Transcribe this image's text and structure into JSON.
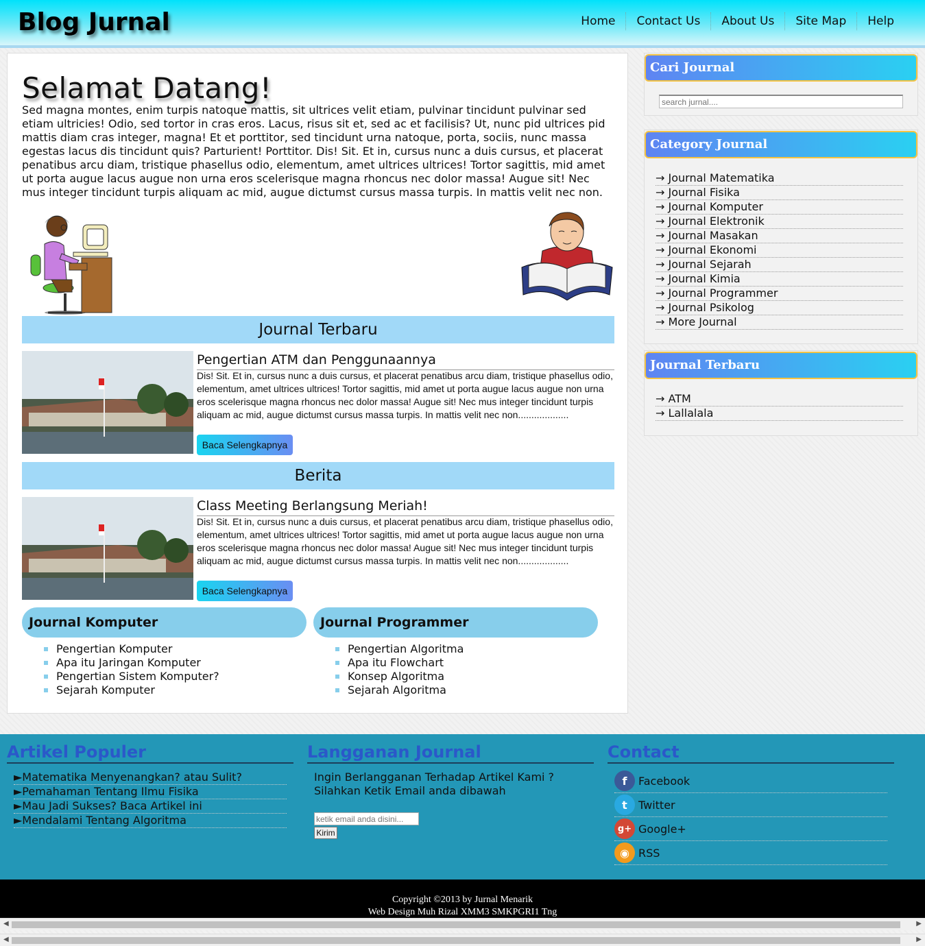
{
  "header": {
    "logo": "Blog Jurnal",
    "nav": [
      "Home",
      "Contact Us",
      "About Us",
      "Site Map",
      "Help"
    ]
  },
  "main": {
    "welcome_title": "Selamat Datang!",
    "intro": "Sed magna montes, enim turpis natoque mattis, sit ultrices velit etiam, pulvinar tincidunt pulvinar sed etiam ultricies! Odio, sed tortor in cras eros. Lacus, risus sit et, sed ac et facilisis? Ut, nunc pid ultrices pid mattis diam cras integer, magna! Et et porttitor, sed tincidunt urna natoque, porta, sociis, nunc massa egestas lacus dis tincidunt quis? Parturient! Porttitor. Dis! Sit. Et in, cursus nunc a duis cursus, et placerat penatibus arcu diam, tristique phasellus odio, elementum, amet ultrices ultrices! Tortor sagittis, mid amet ut porta augue lacus augue non urna eros scelerisque magna rhoncus nec dolor massa! Augue sit! Nec mus integer tincidunt turpis aliquam ac mid, augue dictumst cursus massa turpis. In mattis velit nec non.",
    "section_latest": "Journal Terbaru",
    "post1": {
      "title": "Pengertian ATM dan Penggunaannya",
      "excerpt": "Dis! Sit. Et in, cursus nunc a duis cursus, et placerat penatibus arcu diam, tristique phasellus odio, elementum, amet ultrices ultrices! Tortor sagittis, mid amet ut porta augue lacus augue non urna eros scelerisque magna rhoncus nec dolor massa! Augue sit! Nec mus integer tincidunt turpis aliquam ac mid, augue dictumst cursus massa turpis. In mattis velit nec non...................",
      "button": "Baca Selengkapnya"
    },
    "section_news": "Berita",
    "post2": {
      "title": "Class Meeting Berlangsung Meriah!",
      "excerpt": "Dis! Sit. Et in, cursus nunc a duis cursus, et placerat penatibus arcu diam, tristique phasellus odio, elementum, amet ultrices ultrices! Tortor sagittis, mid amet ut porta augue lacus augue non urna eros scelerisque magna rhoncus nec dolor massa! Augue sit! Nec mus integer tincidunt turpis aliquam ac mid, augue dictumst cursus massa turpis. In mattis velit nec non...................",
      "button": "Baca Selengkapnya"
    },
    "box_komputer": {
      "title": "Journal Komputer",
      "items": [
        "Pengertian Komputer",
        "Apa itu Jaringan Komputer",
        "Pengertian Sistem Komputer?",
        "Sejarah Komputer"
      ]
    },
    "box_programmer": {
      "title": "Journal Programmer",
      "items": [
        "Pengertian Algoritma",
        "Apa itu Flowchart",
        "Konsep Algoritma",
        "Sejarah Algoritma"
      ]
    }
  },
  "sidebar": {
    "search": {
      "title": "Cari Journal",
      "placeholder": "search jurnal...."
    },
    "category": {
      "title": "Category Journal",
      "items": [
        "→ Journal Matematika",
        "→ Journal Fisika",
        "→ Journal Komputer",
        "→ Journal Elektronik",
        "→ Journal Masakan",
        "→ Journal Ekonomi",
        "→ Journal Sejarah",
        "→ Journal Kimia",
        "→ Journal Programmer",
        "→ Journal Psikolog",
        "→ More Journal"
      ]
    },
    "latest": {
      "title": "Journal Terbaru",
      "items": [
        "→ ATM",
        "→ Lallalala"
      ]
    }
  },
  "footer": {
    "popular": {
      "title": "Artikel Populer",
      "items": [
        "►Matematika Menyenangkan? atau Sulit?",
        "►Pemahaman Tentang Ilmu Fisika",
        "►Mau Jadi Sukses? Baca Artikel ini",
        "►Mendalami Tentang Algoritma"
      ]
    },
    "subscribe": {
      "title": "Langganan Journal",
      "text1": "Ingin Berlangganan Terhadap Artikel Kami ?",
      "text2": "Silahkan Ketik Email anda dibawah",
      "placeholder": "ketik email anda disini...",
      "button": "Kirim"
    },
    "contact": {
      "title": "Contact",
      "items": [
        {
          "label": "Facebook",
          "icon": "facebook-icon",
          "color": "#3b5998",
          "glyph": "f"
        },
        {
          "label": "Twitter",
          "icon": "twitter-icon",
          "color": "#29a9e1",
          "glyph": "t"
        },
        {
          "label": "Google+",
          "icon": "google-plus-icon",
          "color": "#d34836",
          "glyph": "g+"
        },
        {
          "label": "RSS",
          "icon": "rss-icon",
          "color": "#f39a1d",
          "glyph": "◉"
        }
      ]
    },
    "copyright1": "Copyright ©2013 by Jurnal Menarik",
    "copyright2": "Web Design Muh Rizal XMM3 SMKPGRI1 Tng"
  },
  "colors": {
    "header_top": "#00e2fb",
    "section_bar": "#a1d9f8",
    "category_head": "#87ceeb",
    "footer_bg": "#2397b7",
    "footer_head": "#2b58c9"
  }
}
